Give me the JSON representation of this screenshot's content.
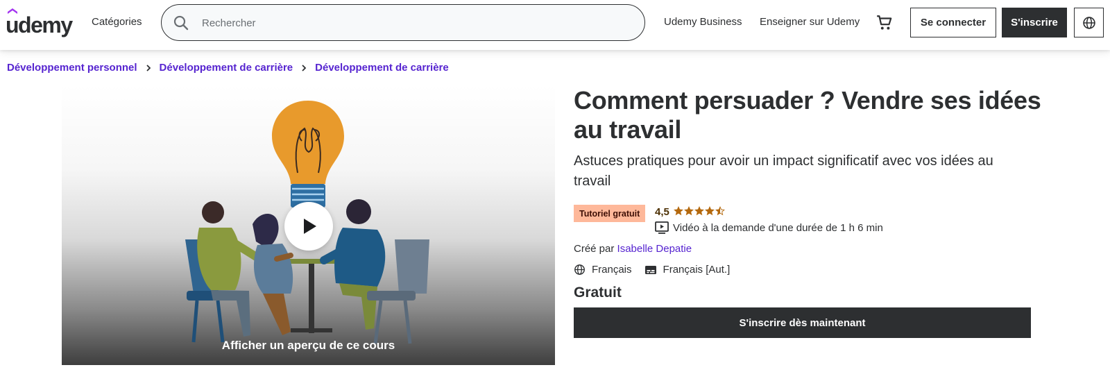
{
  "header": {
    "logo": "udemy",
    "categories": "Catégories",
    "search_placeholder": "Rechercher",
    "business": "Udemy Business",
    "teach": "Enseigner sur Udemy",
    "login": "Se connecter",
    "signup": "S'inscrire"
  },
  "breadcrumb": [
    "Développement personnel",
    "Développement de carrière",
    "Développement de carrière"
  ],
  "preview": {
    "caption": "Afficher un aperçu de ce cours"
  },
  "course": {
    "title": "Comment persuader ? Vendre ses idées au travail",
    "subtitle": "Astuces pratiques pour avoir un impact significatif avec vos idées au travail",
    "badge": "Tutoriel gratuit",
    "rating": "4,5",
    "stars_value": 4.5,
    "video": "Vidéo à la demande d'une durée de 1 h 6 min",
    "created_prefix": "Créé par",
    "author": "Isabelle Depatie",
    "language": "Français",
    "captions": "Français [Aut.]",
    "price": "Gratuit",
    "enroll": "S'inscrire dès maintenant"
  },
  "colors": {
    "brand_purple": "#5624d0",
    "dark": "#2d2f31",
    "badge_bg": "#feb89a",
    "star": "#b4690e"
  },
  "icons": [
    "udemy-logo-icon",
    "search-icon",
    "cart-icon",
    "globe-icon",
    "chevron-right-icon",
    "play-icon",
    "star-icon",
    "video-icon",
    "captions-icon"
  ]
}
